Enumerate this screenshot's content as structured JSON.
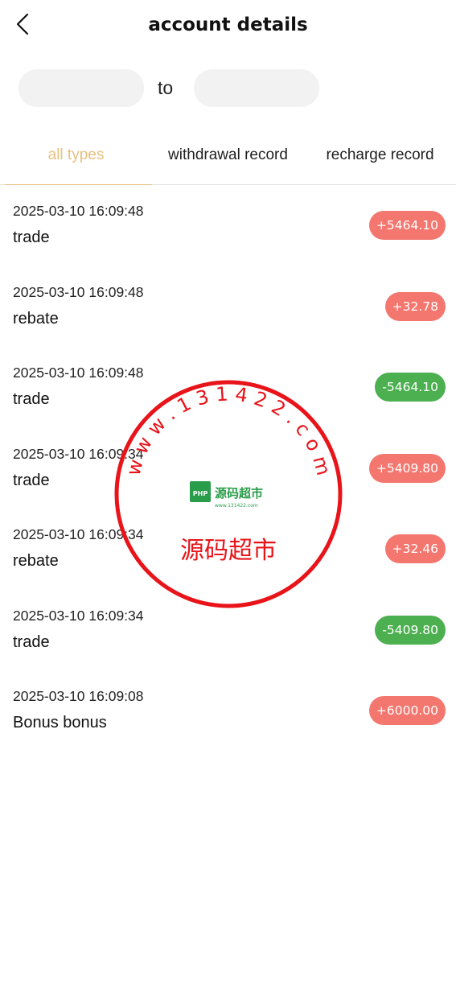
{
  "header": {
    "title": "account details"
  },
  "filter": {
    "to_label": "to",
    "from_value": "",
    "to_value": ""
  },
  "tabs": [
    {
      "label": "all types",
      "active": true
    },
    {
      "label": "withdrawal record",
      "active": false
    },
    {
      "label": "recharge record",
      "active": false
    }
  ],
  "records": [
    {
      "date": "2025-03-10 16:09:48",
      "type": "trade",
      "amount": "+5464.10",
      "sign": "pos"
    },
    {
      "date": "2025-03-10 16:09:48",
      "type": "rebate",
      "amount": "+32.78",
      "sign": "pos"
    },
    {
      "date": "2025-03-10 16:09:48",
      "type": "trade",
      "amount": "-5464.10",
      "sign": "neg"
    },
    {
      "date": "2025-03-10 16:09:34",
      "type": "trade",
      "amount": "+5409.80",
      "sign": "pos"
    },
    {
      "date": "2025-03-10 16:09:34",
      "type": "rebate",
      "amount": "+32.46",
      "sign": "pos"
    },
    {
      "date": "2025-03-10 16:09:34",
      "type": "trade",
      "amount": "-5409.80",
      "sign": "neg"
    },
    {
      "date": "2025-03-10 16:09:08",
      "type": "Bonus bonus",
      "amount": "+6000.00",
      "sign": "pos"
    }
  ],
  "watermark": {
    "ring_text": "w w w . 1 3 1 4 2 2 . c o m",
    "name": "源码超市",
    "logo_badge": "PHP",
    "logo_title": "源码超市",
    "logo_sub": "www.131422.com"
  },
  "colors": {
    "accent": "#e8c07f",
    "positive": "#f4776f",
    "negative": "#4caf50",
    "stamp": "#e8141a"
  }
}
